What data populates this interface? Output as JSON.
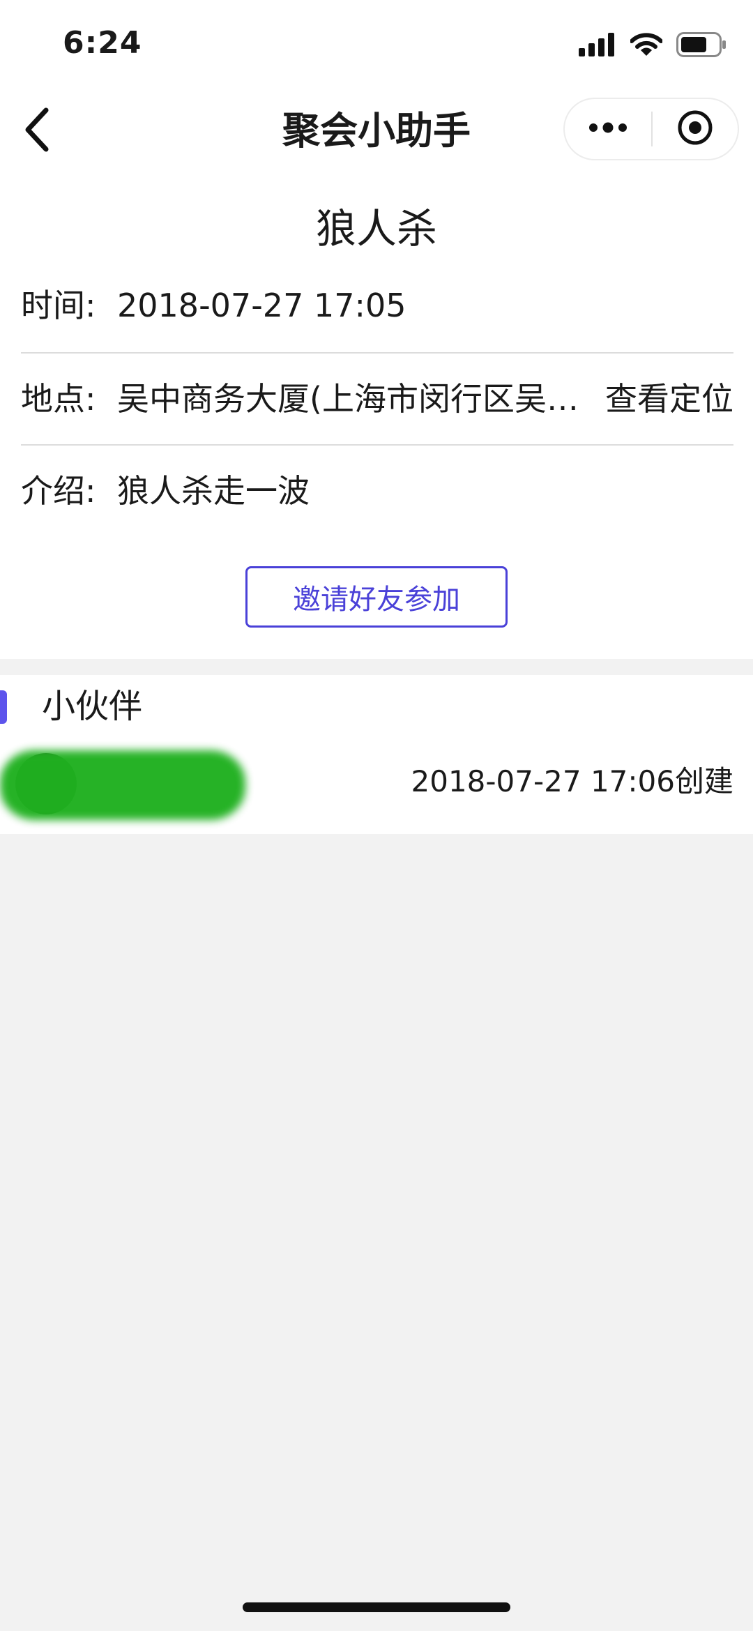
{
  "status_bar": {
    "time": "6:24",
    "icons": [
      "cellular-signal-icon",
      "wifi-icon",
      "battery-icon"
    ]
  },
  "nav": {
    "back_icon": "chevron-left-icon",
    "title": "聚会小助手",
    "capsule": {
      "more_icon": "more-dots-icon",
      "close_icon": "target-circle-icon"
    }
  },
  "event": {
    "title": "狼人杀",
    "time_label": "时间:",
    "time_value": "2018-07-27 17:05",
    "location_label": "地点:",
    "location_value": "吴中商务大厦(上海市闵行区吴…",
    "location_action": "查看定位",
    "intro_label": "介绍:",
    "intro_value": "狼人杀走一波",
    "invite_button": "邀请好友参加"
  },
  "participants": {
    "title": "小伙伴",
    "members": [
      {
        "created": "2018-07-27 17:06创建"
      }
    ]
  },
  "colors": {
    "accent": "#4a41d8",
    "section_bar": "#5d54ec",
    "redaction": "#1fb01f",
    "page_bg": "#f2f2f2",
    "card_bg": "#ffffff"
  }
}
